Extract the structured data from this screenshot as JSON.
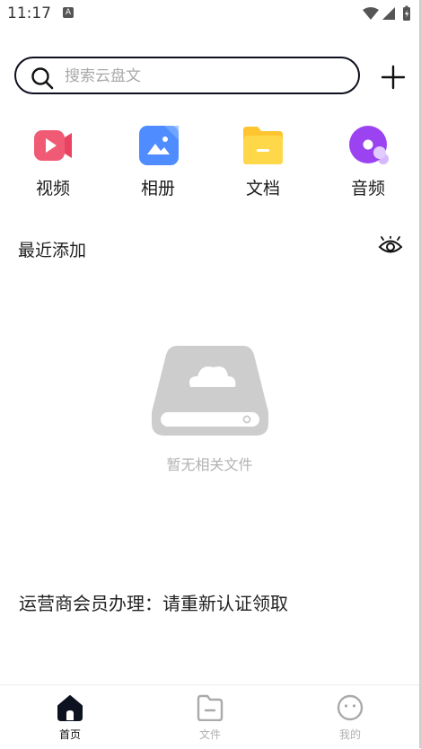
{
  "status_bar": {
    "time": "11:17",
    "indicator": "A"
  },
  "search": {
    "placeholder": "搜索云盘文"
  },
  "categories": [
    {
      "label": "视频",
      "icon": "video-icon",
      "color": "#f05a74"
    },
    {
      "label": "相册",
      "icon": "album-icon",
      "color": "#4e8cff"
    },
    {
      "label": "文档",
      "icon": "document-icon",
      "color": "#ffcc33"
    },
    {
      "label": "音频",
      "icon": "audio-icon",
      "color": "#a855f7"
    }
  ],
  "recent": {
    "title": "最近添加",
    "empty_text": "暂无相关文件"
  },
  "promo": {
    "text": "运营商会员办理：请重新认证领取"
  },
  "bottom_nav": [
    {
      "label": "首页",
      "icon": "home-icon",
      "active": true
    },
    {
      "label": "文件",
      "icon": "folder-icon",
      "active": false
    },
    {
      "label": "我的",
      "icon": "profile-icon",
      "active": false
    }
  ]
}
